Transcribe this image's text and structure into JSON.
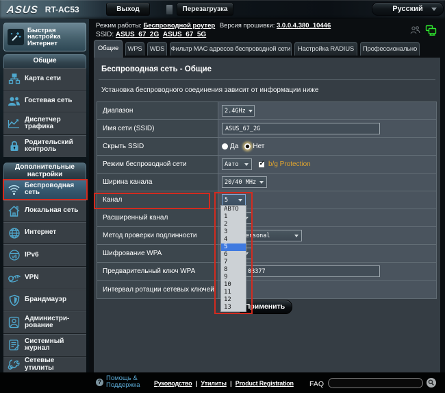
{
  "topbar": {
    "brand": "ASUS",
    "model": "RT-AC53",
    "logout_label": "Выход",
    "reboot_label": "Перезагрузка",
    "language": "Русский"
  },
  "infobar": {
    "mode_label": "Режим работы:",
    "mode_value": "Беспроводной роутер",
    "firmware_label": "Версия прошивки:",
    "firmware_value": "3.0.0.4.380_10446",
    "ssid_label": "SSID:",
    "ssid_2g": "ASUS_67_2G",
    "ssid_5g": "ASUS_67_5G"
  },
  "tabs": [
    {
      "label": "Общие",
      "active": true
    },
    {
      "label": "WPS",
      "active": false
    },
    {
      "label": "WDS",
      "active": false
    },
    {
      "label": "Фильтр MAC адресов беспроводной сети",
      "active": false
    },
    {
      "label": "Настройка RADIUS",
      "active": false
    },
    {
      "label": "Профессионально",
      "active": false
    }
  ],
  "sidebar": {
    "quick_setup": "Быстрая настройка Интернет",
    "sections": [
      {
        "title": "Общие",
        "items": [
          {
            "label": "Карта сети"
          },
          {
            "label": "Гостевая сеть"
          },
          {
            "label": "Диспетчер трафика"
          },
          {
            "label": "Родительский контроль"
          }
        ]
      },
      {
        "title": "Дополнительные настройки",
        "items": [
          {
            "label": "Беспроводная сеть",
            "selected": true
          },
          {
            "label": "Локальная сеть"
          },
          {
            "label": "Интернет"
          },
          {
            "label": "IPv6"
          },
          {
            "label": "VPN"
          },
          {
            "label": "Брандмауэр"
          },
          {
            "label": "Администри-рование"
          },
          {
            "label": "Системный журнал"
          },
          {
            "label": "Сетевые утилиты"
          }
        ]
      }
    ]
  },
  "panel": {
    "title": "Беспроводная сеть - Общие",
    "description": "Установка беспроводного соединения зависит от информации ниже",
    "apply_label": "Применить",
    "rows": [
      {
        "label": "Диапазон",
        "value": "2.4GHz"
      },
      {
        "label": "Имя сети (SSID)",
        "value": "ASUS_67_2G"
      },
      {
        "label": "Скрыть SSID",
        "option_yes": "Да",
        "option_no": "Нет",
        "selected": "Нет"
      },
      {
        "label": "Режим беспроводной сети",
        "value": "Авто",
        "checkbox_label": "b/g Protection",
        "checked": true
      },
      {
        "label": "Ширина канала",
        "value": "20/40 MHz"
      },
      {
        "label": "Канал",
        "value": "5"
      },
      {
        "label": "Расширенный канал",
        "value": ""
      },
      {
        "label": "Метод проверки подлинности",
        "value": "WPA2-Personal"
      },
      {
        "label": "Шифрование WPA",
        "value": ""
      },
      {
        "label": "Предварительный ключ WPA",
        "value": "08377"
      },
      {
        "label": "Интервал ротации сетевых ключей",
        "value": ""
      }
    ]
  },
  "channel_dropdown": {
    "selected": "5",
    "options": [
      "АВТО",
      "1",
      "2",
      "3",
      "4",
      "5",
      "6",
      "7",
      "8",
      "9",
      "10",
      "11",
      "12",
      "13"
    ]
  },
  "footer": {
    "help_label": "Помощь & Поддержка",
    "links": [
      "Руководство",
      "Утилиты",
      "Product Registration"
    ],
    "separator": "|",
    "faq_label": "FAQ",
    "faq_value": ""
  },
  "colors": {
    "annotation_red": "#d22b1f",
    "selection_blue": "#3f7ae0",
    "protection_orange": "#dfa42f",
    "icon_cyan": "#4fa8ce",
    "lan_green": "#2ee62e"
  }
}
